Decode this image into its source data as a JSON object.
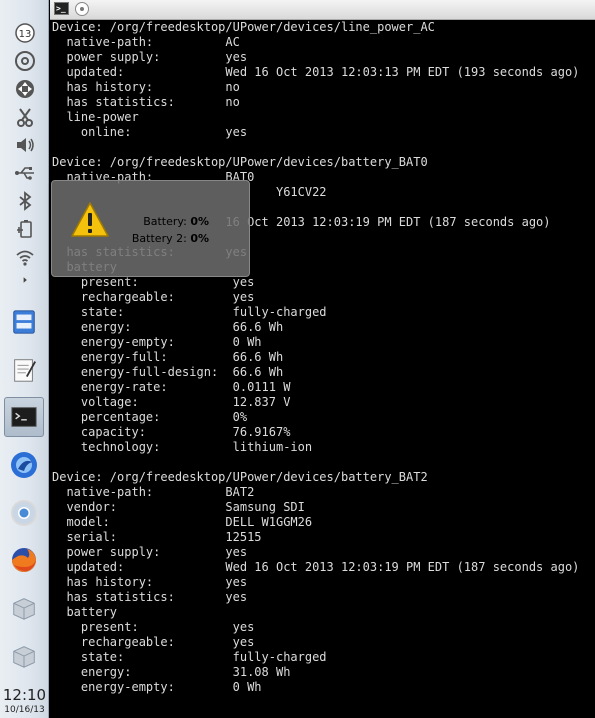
{
  "taskbar": {
    "tray": [
      {
        "icon": "clipboard-calendar-icon",
        "badge": "13"
      },
      {
        "icon": "optical-disc-icon"
      },
      {
        "icon": "move-arrows-icon"
      },
      {
        "icon": "scissors-icon"
      },
      {
        "icon": "speaker-volume-icon"
      },
      {
        "icon": "usb-icon"
      },
      {
        "icon": "bluetooth-icon"
      },
      {
        "icon": "battery-power-icon"
      },
      {
        "icon": "wifi-icon"
      },
      {
        "icon": "tray-expand-arrow-icon"
      }
    ],
    "launchers": [
      {
        "icon": "file-manager-icon"
      },
      {
        "icon": "text-editor-icon"
      },
      {
        "icon": "terminal-icon"
      },
      {
        "icon": "thunderbird-icon"
      },
      {
        "icon": "chrome-icon"
      },
      {
        "icon": "firefox-icon"
      },
      {
        "icon": "package-icon"
      },
      {
        "icon": "package-icon"
      }
    ],
    "clock_time": "12:10",
    "clock_date": "10/16/13"
  },
  "topbar": {
    "tab_icon_text": ">_"
  },
  "terminal": {
    "lines": [
      "Device: /org/freedesktop/UPower/devices/line_power_AC",
      "  native-path:          AC",
      "  power supply:         yes",
      "  updated:              Wed 16 Oct 2013 12:03:13 PM EDT (193 seconds ago)",
      "  has history:          no",
      "  has statistics:       no",
      "  line-power",
      "    online:             yes",
      "",
      "Device: /org/freedesktop/UPower/devices/battery_BAT0",
      "  native-path:          BAT0",
      "                               Y61CV22",
      "",
      "                        16 Oct 2013 12:03:19 PM EDT (187 seconds ago)",
      "",
      "  has statistics:       yes",
      "  battery",
      "    present:             yes",
      "    rechargeable:        yes",
      "    state:               fully-charged",
      "    energy:              66.6 Wh",
      "    energy-empty:        0 Wh",
      "    energy-full:         66.6 Wh",
      "    energy-full-design:  66.6 Wh",
      "    energy-rate:         0.0111 W",
      "    voltage:             12.837 V",
      "    percentage:          0%",
      "    capacity:            76.9167%",
      "    technology:          lithium-ion",
      "",
      "Device: /org/freedesktop/UPower/devices/battery_BAT2",
      "  native-path:          BAT2",
      "  vendor:               Samsung SDI",
      "  model:                DELL W1GGM26",
      "  serial:               12515",
      "  power supply:         yes",
      "  updated:              Wed 16 Oct 2013 12:03:19 PM EDT (187 seconds ago)",
      "  has history:          yes",
      "  has statistics:       yes",
      "  battery",
      "    present:             yes",
      "    rechargeable:        yes",
      "    state:               fully-charged",
      "    energy:              31.08 Wh",
      "    energy-empty:        0 Wh"
    ]
  },
  "notification": {
    "icon": "warning-icon",
    "line1_label": "Battery:",
    "line1_value": "0%",
    "line2_label": "Battery 2:",
    "line2_value": "0%"
  }
}
